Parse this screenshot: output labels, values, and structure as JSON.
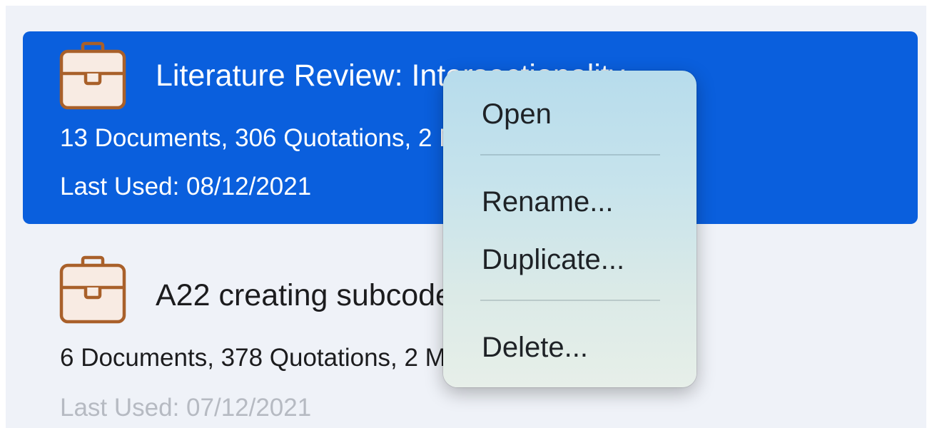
{
  "projects": [
    {
      "title": "Literature Review: Intersectionality",
      "stats": "13 Documents, 306 Quotations, 2 Memos",
      "last_used": "Last Used: 08/12/2021",
      "selected": true,
      "icon": "briefcase-icon"
    },
    {
      "title": "A22 creating subcodes",
      "stats": "6 Documents, 378 Quotations, 2 Memos",
      "last_used": "Last Used: 07/12/2021",
      "selected": false,
      "icon": "briefcase-icon"
    }
  ],
  "context_menu": {
    "items": [
      "Open",
      "Rename...",
      "Duplicate...",
      "Delete..."
    ]
  },
  "colors": {
    "selection": "#0a5fdd",
    "briefcase_stroke": "#a9602a",
    "briefcase_fill": "#f8ebe3",
    "background": "#eff2f8"
  }
}
